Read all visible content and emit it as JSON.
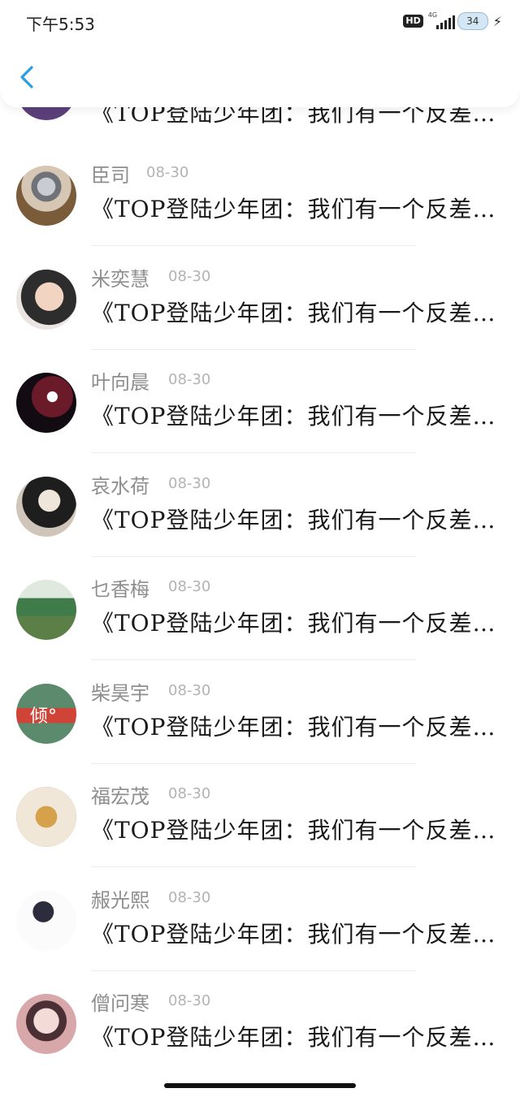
{
  "status_bar": {
    "time": "下午5:53",
    "hd": "HD",
    "network": "4G",
    "battery": "34"
  },
  "nav": {
    "back_icon": "chevron-left-icon",
    "accent": "#2a9fe6"
  },
  "comments": [
    {
      "name": "",
      "date": "",
      "title": "《TOP登陆少年团：我们有一个反差…"
    },
    {
      "name": "臣司",
      "date": "08-30",
      "title": "《TOP登陆少年团：我们有一个反差…"
    },
    {
      "name": "米奕慧",
      "date": "08-30",
      "title": "《TOP登陆少年团：我们有一个反差…"
    },
    {
      "name": "叶向晨",
      "date": "08-30",
      "title": "《TOP登陆少年团：我们有一个反差…"
    },
    {
      "name": "哀水荷",
      "date": "08-30",
      "title": "《TOP登陆少年团：我们有一个反差…"
    },
    {
      "name": "乜香梅",
      "date": "08-30",
      "title": "《TOP登陆少年团：我们有一个反差…"
    },
    {
      "name": "柴昊宇",
      "date": "08-30",
      "title": "《TOP登陆少年团：我们有一个反差…"
    },
    {
      "name": "福宏茂",
      "date": "08-30",
      "title": "《TOP登陆少年团：我们有一个反差…"
    },
    {
      "name": "赧光熙",
      "date": "08-30",
      "title": "《TOP登陆少年团：我们有一个反差…"
    },
    {
      "name": "僧问寒",
      "date": "08-30",
      "title": "《TOP登陆少年团：我们有一个反差…"
    }
  ],
  "avatar_texts": {
    "柴昊宇": "倾°"
  }
}
